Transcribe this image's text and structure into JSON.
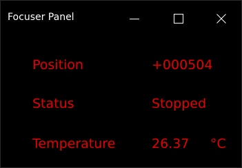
{
  "window": {
    "title": "Focuser Panel",
    "controls": {
      "minimize_icon": "minimize-icon",
      "maximize_icon": "maximize-icon",
      "close_icon": "close-icon"
    }
  },
  "panel": {
    "rows": [
      {
        "label": "Position",
        "value": "+000504",
        "unit": ""
      },
      {
        "label": "Status",
        "value": "Stopped",
        "unit": ""
      },
      {
        "label": "Temperature",
        "value": "26.37",
        "unit": "°C"
      }
    ]
  },
  "colors": {
    "background": "#000000",
    "title_text": "#ffffff",
    "panel_text": "#e60000"
  }
}
